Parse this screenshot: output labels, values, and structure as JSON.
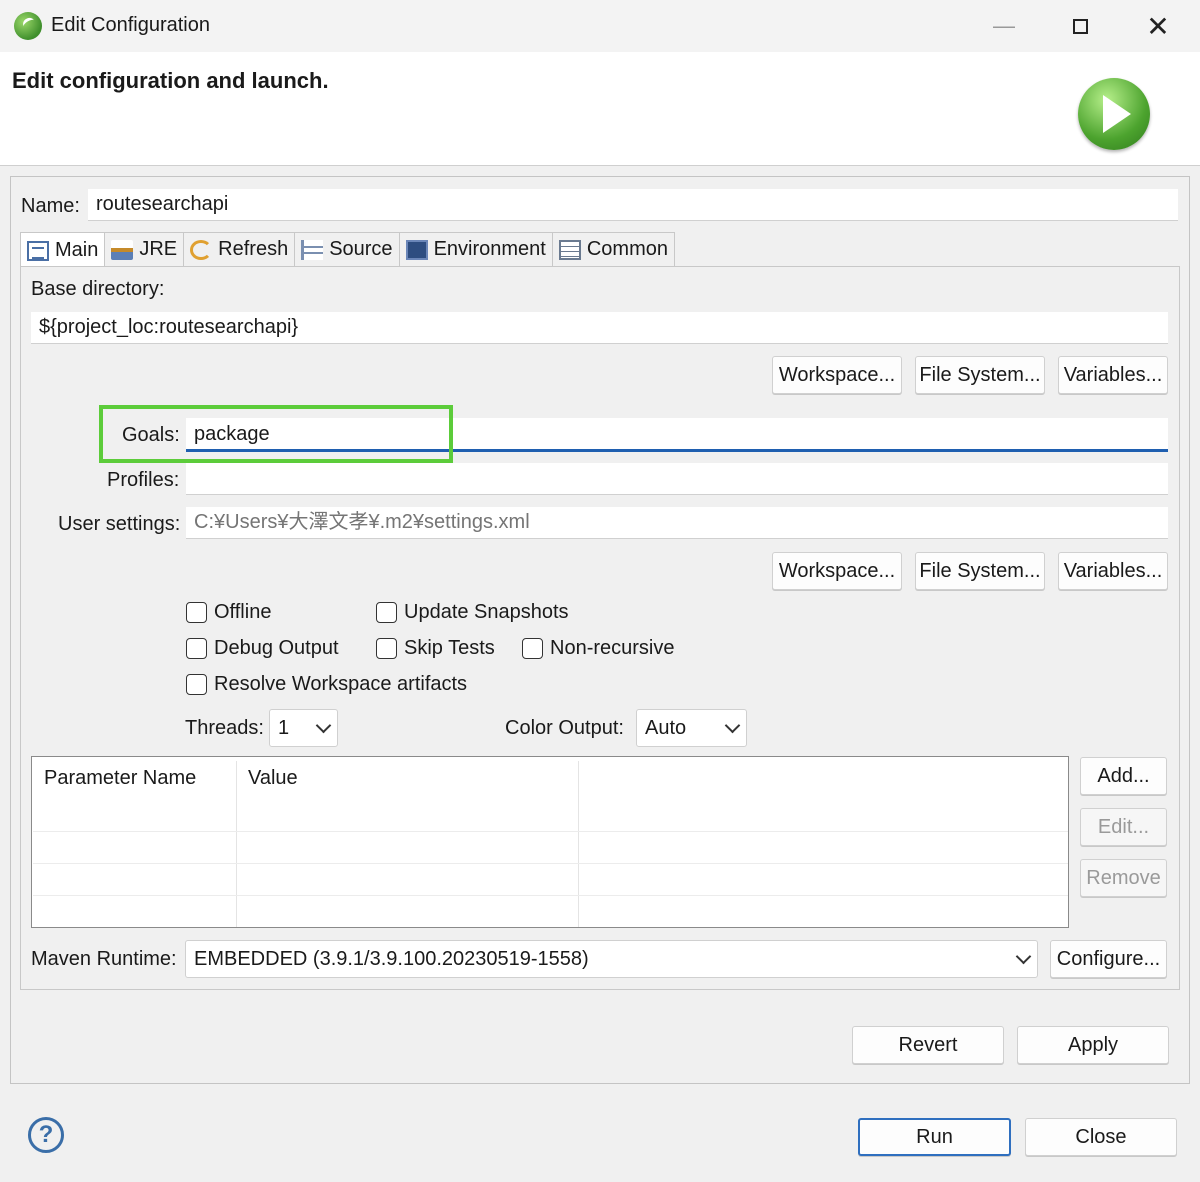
{
  "window": {
    "title": "Edit Configuration",
    "minimize": "—",
    "close": "✕"
  },
  "header": {
    "title": "Edit configuration and launch."
  },
  "name": {
    "label": "Name:",
    "value": "routesearchapi"
  },
  "tabs": [
    {
      "label": "Main",
      "icon": "main-tab-icon",
      "active": true
    },
    {
      "label": "JRE",
      "icon": "jre-tab-icon"
    },
    {
      "label": "Refresh",
      "icon": "refresh-tab-icon"
    },
    {
      "label": "Source",
      "icon": "source-tab-icon"
    },
    {
      "label": "Environment",
      "icon": "environment-tab-icon"
    },
    {
      "label": "Common",
      "icon": "common-tab-icon"
    }
  ],
  "main": {
    "base_directory_label": "Base directory:",
    "base_directory_value": "${project_loc:routesearchapi}",
    "buttons1": {
      "workspace": "Workspace...",
      "file_system": "File System...",
      "variables": "Variables..."
    },
    "goals_label": "Goals:",
    "goals_value": "package",
    "profiles_label": "Profiles:",
    "profiles_value": "",
    "user_settings_label": "User settings:",
    "user_settings_placeholder": "C:¥Users¥大澤文孝¥.m2¥settings.xml",
    "buttons2": {
      "workspace": "Workspace...",
      "file_system": "File System...",
      "variables": "Variables..."
    },
    "checkboxes": {
      "offline": "Offline",
      "update_snapshots": "Update Snapshots",
      "debug_output": "Debug Output",
      "skip_tests": "Skip Tests",
      "non_recursive": "Non-recursive",
      "resolve_workspace": "Resolve Workspace artifacts"
    },
    "threads_label": "Threads:",
    "threads_value": "1",
    "color_output_label": "Color Output:",
    "color_output_value": "Auto",
    "table": {
      "col_name": "Parameter Name",
      "col_value": "Value"
    },
    "table_buttons": {
      "add": "Add...",
      "edit": "Edit...",
      "remove": "Remove"
    },
    "maven_runtime_label": "Maven Runtime:",
    "maven_runtime_value": "EMBEDDED (3.9.1/3.9.100.20230519-1558)",
    "configure": "Configure..."
  },
  "actions": {
    "revert": "Revert",
    "apply": "Apply"
  },
  "footer": {
    "help": "?",
    "run": "Run",
    "close": "Close"
  },
  "colors": {
    "highlight": "#5ccc3a",
    "focus_underline": "#1f5fb0",
    "run_icon": "#4ca32e"
  }
}
